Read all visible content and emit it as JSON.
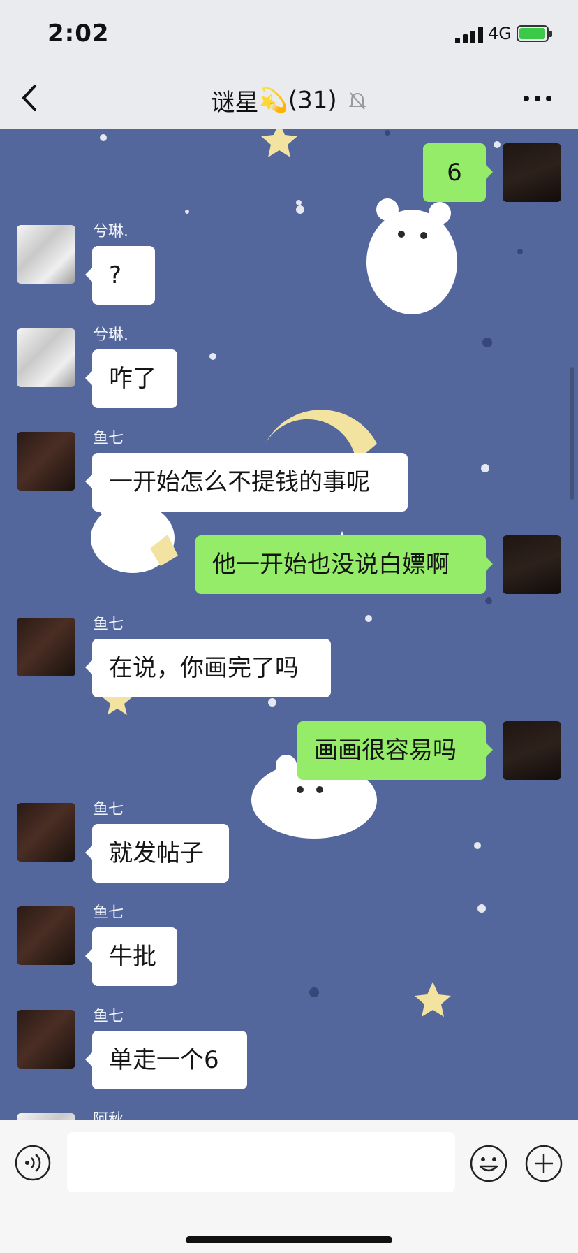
{
  "status": {
    "time": "2:02",
    "network": "4G",
    "battery_color": "#3bc94a"
  },
  "header": {
    "title": "谜星",
    "title_emoji": "💫",
    "member_count": "(31)",
    "muted_icon": "bell-slash-icon"
  },
  "messages": [
    {
      "side": "out",
      "text": "6"
    },
    {
      "side": "in",
      "sender": "兮琳.",
      "text": "?"
    },
    {
      "side": "in",
      "sender": "兮琳.",
      "text": "咋了"
    },
    {
      "side": "in",
      "sender": "鱼七",
      "text": "一开始怎么不提钱的事呢"
    },
    {
      "side": "out",
      "text": "他一开始也没说白嫖啊"
    },
    {
      "side": "in",
      "sender": "鱼七",
      "text": "在说，你画完了吗"
    },
    {
      "side": "out",
      "text": "画画很容易吗"
    },
    {
      "side": "in",
      "sender": "鱼七",
      "text": "就发帖子"
    },
    {
      "side": "in",
      "sender": "鱼七",
      "text": "牛批"
    },
    {
      "side": "in",
      "sender": "鱼七",
      "text": "单走一个6"
    },
    {
      "side": "in",
      "sender": "阿秋",
      "text": ""
    }
  ],
  "input": {
    "placeholder": ""
  },
  "colors": {
    "chat_bg": "#53679c",
    "out_bubble": "#95ec69",
    "in_bubble": "#ffffff"
  }
}
